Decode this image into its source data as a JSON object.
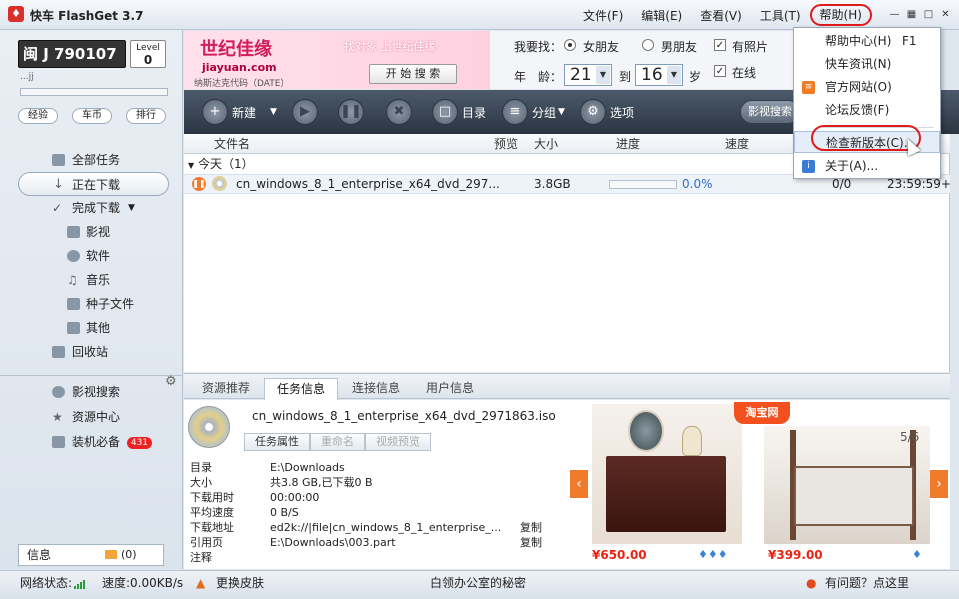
{
  "app": {
    "title": "快车 FlashGet 3.7",
    "logo_icon": "flashget-logo-icon"
  },
  "menu": [
    "文件(F)",
    "编辑(E)",
    "查看(V)",
    "工具(T)",
    "帮助(H)"
  ],
  "user": {
    "name": "闽 J 790107",
    "level_label": "Level",
    "level_value": "0",
    "sub": "...jj",
    "buttons": [
      "经验",
      "车币",
      "排行"
    ]
  },
  "nav": {
    "items": [
      "全部任务",
      "正在下载",
      "完成下载",
      "影视",
      "软件",
      "音乐",
      "种子文件",
      "其他",
      "回收站"
    ],
    "lower": [
      "影视搜索",
      "资源中心",
      "装机必备"
    ],
    "badge": "431",
    "info_label": "信息",
    "info_count": "(0)"
  },
  "banner": {
    "logo": "世纪佳缘",
    "url": "jiayuan.com",
    "code": "纳斯达克代码（DATE）",
    "slogan": "找对象 上世纪佳缘",
    "search_btn": "开 始 搜 索"
  },
  "find": {
    "label": "我要找：",
    "opt1": "女朋友",
    "opt2": "男朋友",
    "chk1": "有照片",
    "chk2": "在线",
    "age_label": "年　龄：",
    "age_from": "21",
    "to": "到",
    "age_to": "16",
    "unit": "岁"
  },
  "toolbar": {
    "new": "新建",
    "dir": "目录",
    "group": "分组",
    "options": "选项",
    "video_search": "影视搜索"
  },
  "list": {
    "columns": [
      "文件名",
      "预览",
      "大小",
      "进度",
      "速度"
    ],
    "group": "今天（1）",
    "row": {
      "name": "cn_windows_8_1_enterprise_x64_dvd_297...",
      "size": "3.8GB",
      "progress": "0.0%",
      "conn": "0/0",
      "time": "23:59:59+",
      "progress_value": 0.0
    }
  },
  "tabs": [
    "资源推荐",
    "任务信息",
    "连接信息",
    "用户信息"
  ],
  "detail": {
    "filename": "cn_windows_8_1_enterprise_x64_dvd_2971863.iso",
    "buttons": [
      "任务属性",
      "重命名",
      "视频预览"
    ],
    "rows": [
      {
        "k": "目录",
        "v": "E:\\Downloads",
        "c": ""
      },
      {
        "k": "大小",
        "v": "共3.8 GB,已下载0 B",
        "c": ""
      },
      {
        "k": "下载用时",
        "v": "00:00:00",
        "c": ""
      },
      {
        "k": "平均速度",
        "v": "0 B/S",
        "c": ""
      },
      {
        "k": "下载地址",
        "v": "ed2k://|file|cn_windows_8_1_enterprise_...",
        "c": "复制"
      },
      {
        "k": "引用页",
        "v": "E:\\Downloads\\003.part",
        "c": "复制"
      },
      {
        "k": "注释",
        "v": "",
        "c": ""
      }
    ]
  },
  "ad": {
    "badge": "淘宝网",
    "page": "5/6",
    "price1": "¥650.00",
    "price2": "¥399.00"
  },
  "status": {
    "net": "网络状态:",
    "speed": "速度:0.00KB/s",
    "skin": "更换皮肤",
    "center": "白领办公室的秘密",
    "help": "有问题？点这里"
  },
  "dropdown": [
    {
      "label": "帮助中心(H)",
      "shortcut": "F1"
    },
    {
      "label": "快车资讯(N)",
      "shortcut": ""
    },
    {
      "label": "官方网站(O)",
      "shortcut": ""
    },
    {
      "label": "论坛反馈(F)",
      "shortcut": ""
    },
    {
      "label": "检查新版本(C)...",
      "shortcut": ""
    },
    {
      "label": "关于(A)...",
      "shortcut": ""
    }
  ],
  "colors": {
    "accent": "#f07b2a",
    "annotation": "#e01b1b",
    "toolbar": "#2b3542"
  }
}
